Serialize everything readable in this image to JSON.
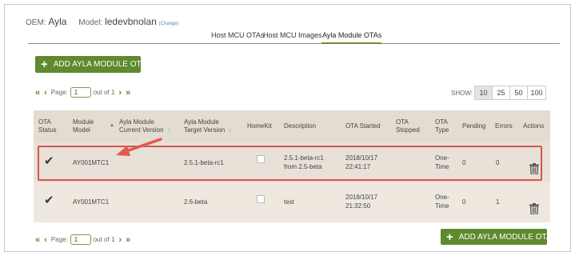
{
  "header": {
    "oem_label": "OEM:",
    "oem_value": "Ayla",
    "model_label": "Model:",
    "model_value": "ledevbnolan",
    "change_link": "(Change)"
  },
  "tabs": [
    {
      "label": "Host MCU OTAs",
      "active": false
    },
    {
      "label": "Host MCU Images",
      "active": false
    },
    {
      "label": "Ayla Module OTAs",
      "active": true
    }
  ],
  "add_button": {
    "label": "ADD AYLA MODULE OTA",
    "icon": "plus-icon",
    "color": "#5f8a2d"
  },
  "pager": {
    "first_icon": "«",
    "prev_icon": "‹",
    "next_icon": "›",
    "last_icon": "»",
    "page_label": "Page:",
    "page_value": "1",
    "of_label": "out of 1"
  },
  "show": {
    "label": "SHOW:",
    "options": [
      "10",
      "25",
      "50",
      "100"
    ],
    "selected": "10"
  },
  "table": {
    "columns": [
      {
        "label": "OTA\nStatus"
      },
      {
        "label": "Module\nModel",
        "sorted": "asc"
      },
      {
        "label": "Ayla Module\nCurrent Version"
      },
      {
        "label": "Ayla Module\nTarget Version"
      },
      {
        "label": "HomeKit"
      },
      {
        "label": "Description"
      },
      {
        "label": "OTA Started"
      },
      {
        "label": "OTA\nStopped"
      },
      {
        "label": "OTA\nType"
      },
      {
        "label": "Pending"
      },
      {
        "label": "Errors"
      },
      {
        "label": "Actions"
      }
    ],
    "rows": [
      {
        "status_icon": "check-icon",
        "module_model": "AY001MTC1",
        "current_version": "",
        "target_version": "2.5.1-beta-rc1",
        "homekit": false,
        "description": "2.5.1-beta-rc1\nfrom 2.5-beta",
        "ota_started": "2018/10/17\n22:41:17",
        "ota_stopped": "",
        "ota_type": "One-\nTime",
        "pending": "0",
        "errors": "0",
        "action_icon": "trash-icon",
        "highlighted": true
      },
      {
        "status_icon": "check-icon",
        "module_model": "AY001MTC1",
        "current_version": "",
        "target_version": "2.6-beta",
        "homekit": false,
        "description": "test",
        "ota_started": "2018/10/17\n21:32:50",
        "ota_stopped": "",
        "ota_type": "One-\nTime",
        "pending": "0",
        "errors": "1",
        "action_icon": "trash-icon",
        "highlighted": false
      }
    ]
  },
  "annotation": {
    "highlight_color": "#d9534f",
    "arrow_color": "#e05a4e"
  }
}
